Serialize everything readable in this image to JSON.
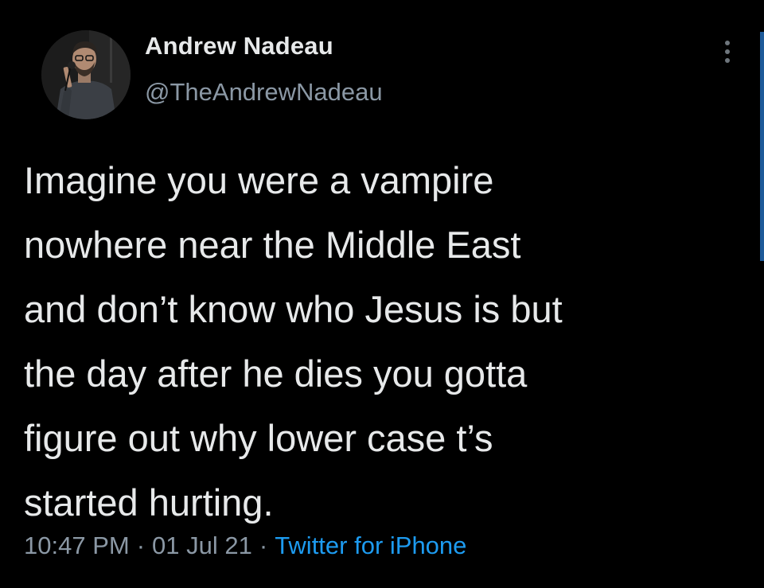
{
  "author": {
    "display_name": "Andrew Nadeau",
    "handle": "@TheAndrewNadeau",
    "avatar_icon": "avatar-photo"
  },
  "tweet": {
    "lines": [
      "Imagine you were a vampire",
      "nowhere near the Middle East",
      "and don’t know who Jesus is but",
      "the day after he dies you gotta",
      "figure out why lower case t’s",
      "started hurting."
    ],
    "time": "10:47 PM",
    "separator": "·",
    "date": "01 Jul 21",
    "source": "Twitter for iPhone"
  },
  "icons": {
    "more": "more-vertical-icon"
  },
  "colors": {
    "background": "#000000",
    "primary_text": "#e7e9ea",
    "secondary_text": "#8b98a5",
    "link": "#1d9bf0",
    "scroll_indicator": "#1d5a99"
  }
}
